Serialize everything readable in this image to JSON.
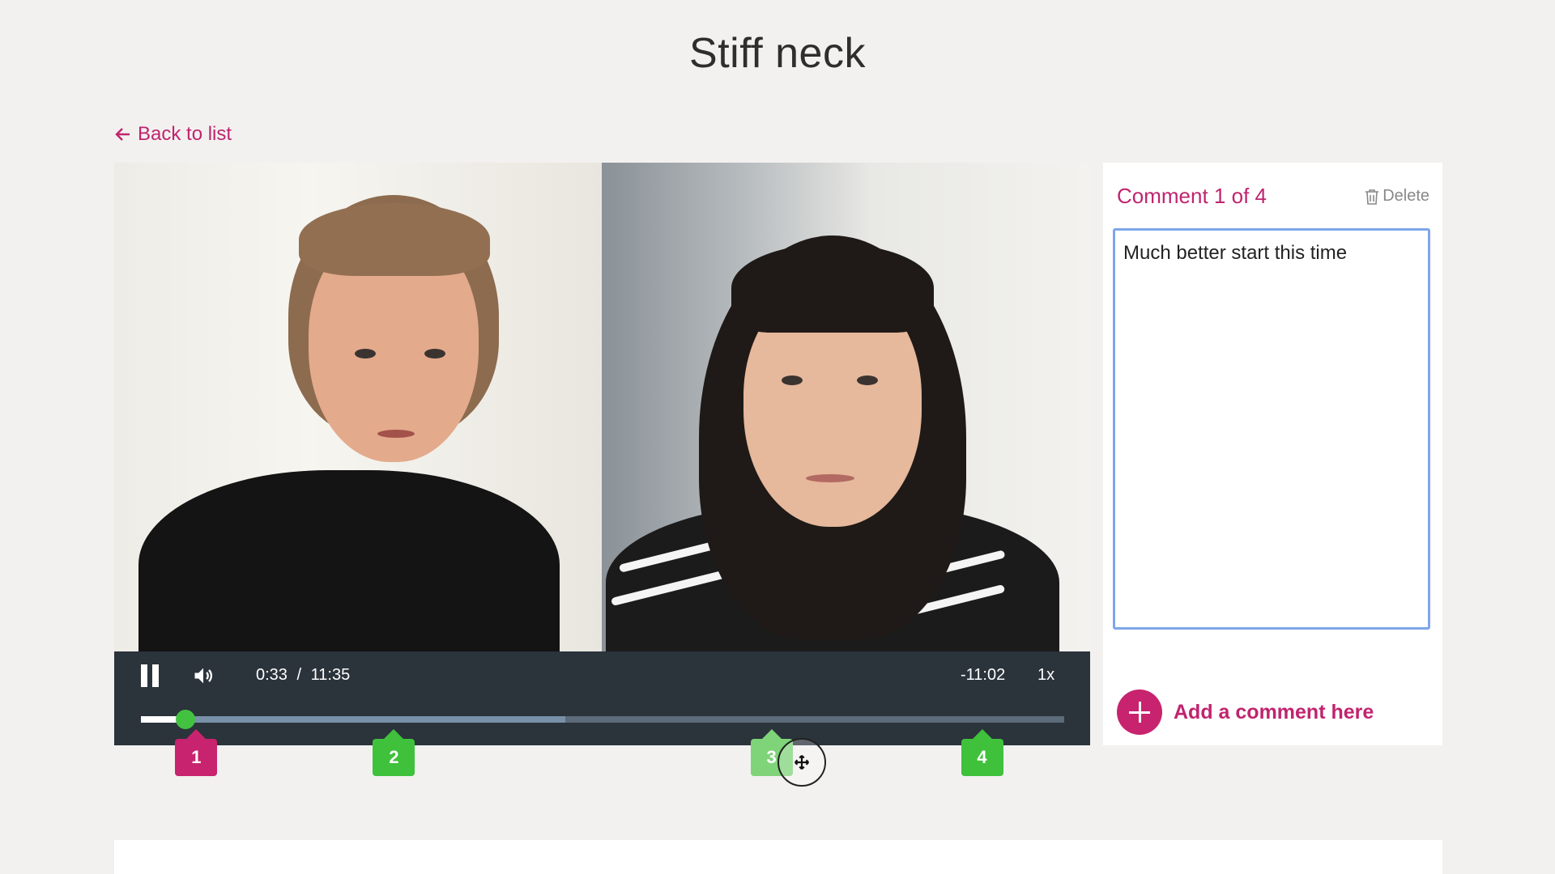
{
  "page": {
    "title": "Stiff neck"
  },
  "nav": {
    "back_label": "Back to list",
    "back_icon": "arrow-left-icon"
  },
  "player": {
    "current_time": "0:33",
    "separator": "/",
    "duration": "11:35",
    "remaining": "-11:02",
    "speed": "1x",
    "state": "playing",
    "played_fraction": 0.048,
    "buffered_fraction": 0.46,
    "icons": {
      "pause": "pause-icon",
      "volume": "volume-icon"
    }
  },
  "markers": [
    {
      "label": "1",
      "position_fraction": 0.06,
      "state": "active"
    },
    {
      "label": "2",
      "position_fraction": 0.274,
      "state": "normal"
    },
    {
      "label": "3",
      "position_fraction": 0.683,
      "state": "dragging"
    },
    {
      "label": "4",
      "position_fraction": 0.911,
      "state": "normal"
    }
  ],
  "comment_panel": {
    "header": "Comment 1 of 4",
    "delete_label": "Delete",
    "delete_icon": "trash-icon",
    "comment_text": "Much better start this time",
    "add_label": "Add a comment here",
    "add_icon": "plus-circle-icon"
  },
  "colors": {
    "accent": "#c0246f",
    "marker_green": "#3fc13c",
    "marker_active": "#c8236f",
    "player_bg": "#2b333b",
    "page_bg": "#f2f1ef"
  }
}
